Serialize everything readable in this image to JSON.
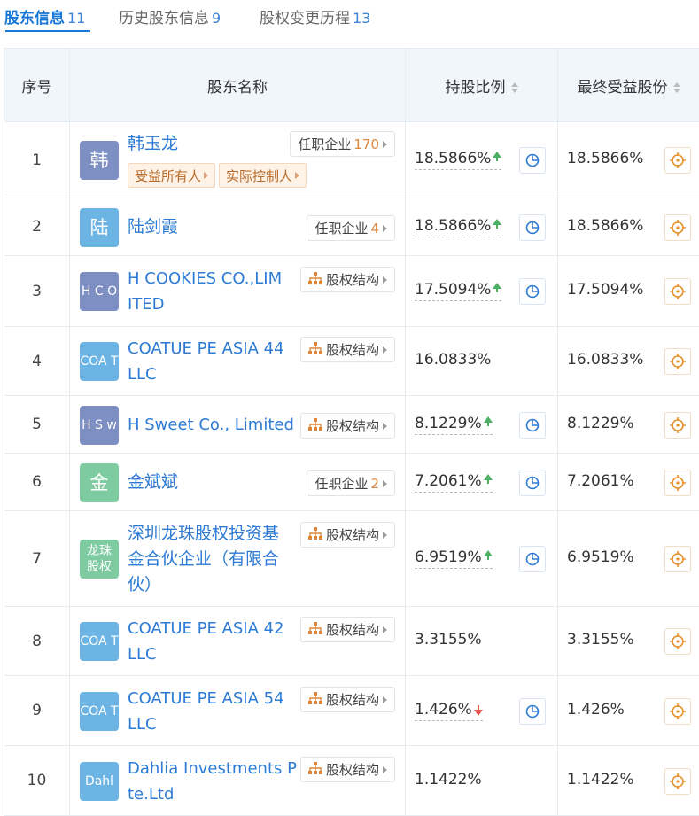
{
  "tabs": [
    {
      "label": "股东信息",
      "count": "11"
    },
    {
      "label": "历史股东信息",
      "count": "9"
    },
    {
      "label": "股权变更历程",
      "count": "13"
    }
  ],
  "columns": {
    "index": "序号",
    "name": "股东名称",
    "ratio": "持股比例",
    "final": "最终受益股份"
  },
  "rows": [
    {
      "index": "1",
      "avatar": "韩",
      "avatar_color": "#7e8fc4",
      "name_line1": "韩玉龙",
      "name_line2": "",
      "tag_label": "任职企业",
      "tag_count": "170",
      "badge1": "受益所有人",
      "badge2": "实际控制人",
      "ratio": "18.5866%",
      "trend": "up",
      "final": "18.5866%"
    },
    {
      "index": "2",
      "avatar": "陆",
      "avatar_color": "#6cb4e4",
      "name_line1": "陆剑霞",
      "name_line2": "",
      "tag_label": "任职企业",
      "tag_count": "4",
      "ratio": "18.5866%",
      "trend": "up",
      "final": "18.5866%"
    },
    {
      "index": "3",
      "avatar": "H C O",
      "avatar_color": "#7e8fc4",
      "name_line1": "H COOKIES CO.,LIM",
      "name_line2": "ITED",
      "tag_label": "股权结构",
      "ratio": "17.5094%",
      "trend": "up",
      "final": "17.5094%"
    },
    {
      "index": "4",
      "avatar": "COA T",
      "avatar_color": "#6cb4e4",
      "name_line1": "COATUE PE ASIA 44",
      "name_line2": "LLC",
      "tag_label": "股权结构",
      "ratio": "16.0833%",
      "trend": "none",
      "final": "16.0833%"
    },
    {
      "index": "5",
      "avatar": "H S w",
      "avatar_color": "#7e8fc4",
      "name_line1": "H Sweet Co., Limited",
      "name_line2": "",
      "tag_label": "股权结构",
      "ratio": "8.1229%",
      "trend": "up",
      "final": "8.1229%"
    },
    {
      "index": "6",
      "avatar": "金",
      "avatar_color": "#7ecba1",
      "name_line1": "金斌斌",
      "name_line2": "",
      "tag_label": "任职企业",
      "tag_count": "2",
      "ratio": "7.2061%",
      "trend": "up",
      "final": "7.2061%"
    },
    {
      "index": "7",
      "avatar": "龙珠 股权",
      "avatar_color": "#7ecba1",
      "name_line1": "深圳龙珠股权投资基",
      "name_line2": "金合伙企业（有限合",
      "name_line3": "伙）",
      "tag_label": "股权结构",
      "ratio": "6.9519%",
      "trend": "up",
      "final": "6.9519%"
    },
    {
      "index": "8",
      "avatar": "COA T",
      "avatar_color": "#6cb4e4",
      "name_line1": "COATUE PE ASIA 42",
      "name_line2": "LLC",
      "tag_label": "股权结构",
      "ratio": "3.3155%",
      "trend": "none",
      "final": "3.3155%"
    },
    {
      "index": "9",
      "avatar": "COA T",
      "avatar_color": "#6cb4e4",
      "name_line1": "COATUE PE ASIA 54",
      "name_line2": "LLC",
      "tag_label": "股权结构",
      "ratio": "1.426%",
      "trend": "down",
      "final": "1.426%"
    },
    {
      "index": "10",
      "avatar": "Dahl",
      "avatar_color": "#6cb4e4",
      "name_line1": "Dahlia Investments P",
      "name_line2": "te.Ltd",
      "tag_label": "股权结构",
      "ratio": "1.1422%",
      "trend": "none",
      "final": "1.1422%"
    }
  ],
  "colors": {
    "link": "#2d7bd4",
    "active_tab": "#1677d6",
    "header_bg": "#f1f6fd",
    "up": "#4caf63",
    "down": "#e5534b",
    "count_orange": "#e0863a"
  }
}
